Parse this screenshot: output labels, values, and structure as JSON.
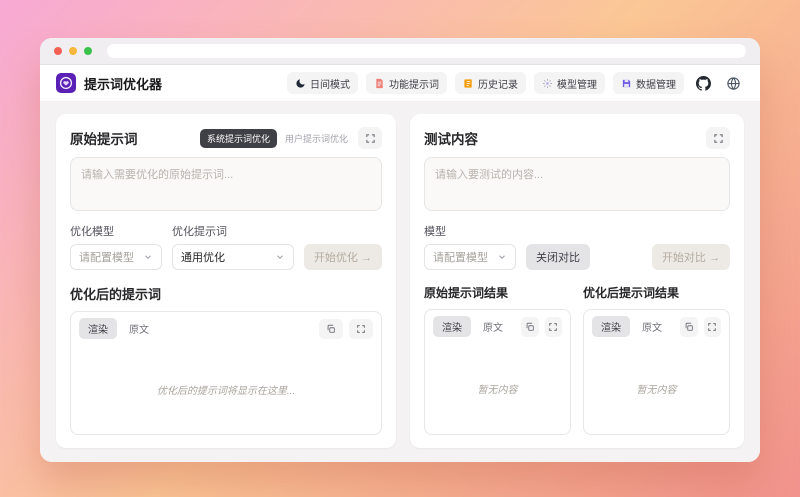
{
  "browser": {
    "address_value": ""
  },
  "header": {
    "app_title": "提示词优化器",
    "nav": [
      {
        "label": "日间模式",
        "icon": "moon-icon"
      },
      {
        "label": "功能提示词",
        "icon": "template-icon"
      },
      {
        "label": "历史记录",
        "icon": "history-icon"
      },
      {
        "label": "模型管理",
        "icon": "model-icon"
      },
      {
        "label": "数据管理",
        "icon": "data-icon"
      }
    ],
    "github_icon": "github-icon",
    "language_icon": "globe-icon"
  },
  "left_panel": {
    "title": "原始提示词",
    "mode_active": "系统提示词优化",
    "mode_inactive": "用户提示词优化",
    "input_placeholder": "请输入需要优化的原始提示词...",
    "model_label": "优化模型",
    "model_select_value": "请配置模型",
    "template_label": "优化提示词",
    "template_select_value": "通用优化",
    "optimize_button": "开始优化 →",
    "result_section_title": "优化后的提示词",
    "render_tab": "渲染",
    "source_tab": "原文",
    "empty_text": "优化后的提示词将显示在这里..."
  },
  "right_panel": {
    "title": "测试内容",
    "input_placeholder": "请输入要测试的内容...",
    "model_label": "模型",
    "model_select_value": "请配置模型",
    "compare_toggle_button": "关闭对比",
    "start_compare_button": "开始对比 →",
    "results": [
      {
        "title": "原始提示词结果",
        "render_tab": "渲染",
        "source_tab": "原文",
        "empty_text": "暂无内容"
      },
      {
        "title": "优化后提示词结果",
        "render_tab": "渲染",
        "source_tab": "原文",
        "empty_text": "暂无内容"
      }
    ]
  },
  "colors": {
    "accent_purple": "#5b21b6",
    "bg_gradient_start": "#f8a9d4",
    "bg_gradient_mid": "#fbc795",
    "bg_gradient_end": "#f2938d",
    "history_orange": "#f59e0b",
    "data_indigo": "#6d5ce6",
    "doc_red": "#ec8079",
    "traffic_red": "#f45f53",
    "traffic_yellow": "#f6b73c",
    "traffic_green": "#3ac24b"
  }
}
